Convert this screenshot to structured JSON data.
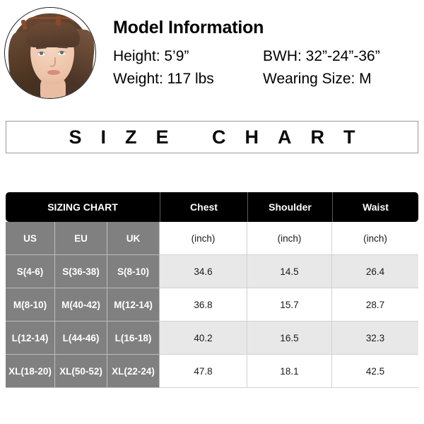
{
  "model": {
    "title": "Model Information",
    "photo_alt": "model-portrait",
    "rows": [
      {
        "left": "Height: 5’9”",
        "right": "BWH: 32”-24”-36”"
      },
      {
        "left": "Weight: 117 lbs",
        "right": "Wearing Size: M"
      }
    ]
  },
  "banner": {
    "text": "SIZE CHART"
  },
  "table": {
    "header": {
      "sizing_chart": "SIZING CHART",
      "chest": "Chest",
      "shoulder": "Shoulder",
      "waist": "Waist"
    },
    "subheader": {
      "us": "US",
      "eu": "EU",
      "uk": "UK",
      "chest_unit": "(inch)",
      "shoulder_unit": "(inch)",
      "waist_unit": "(inch)"
    },
    "rows": [
      {
        "us": "S(4-6)",
        "eu": "S(36-38)",
        "uk": "S(8-10)",
        "chest": "34.6",
        "shoulder": "14.5",
        "waist": "26.4"
      },
      {
        "us": "M(8-10)",
        "eu": "M(40-42)",
        "uk": "M(12-14)",
        "chest": "36.8",
        "shoulder": "15.7",
        "waist": "28.7"
      },
      {
        "us": "L(12-14)",
        "eu": "L(44-46)",
        "uk": "L(16-18)",
        "chest": "40.2",
        "shoulder": "16.5",
        "waist": "32.3"
      },
      {
        "us": "XL(18-20)",
        "eu": "XL(50-52)",
        "uk": "XL(22-24)",
        "chest": "47.8",
        "shoulder": "18.1",
        "waist": "42.5"
      }
    ]
  },
  "colors": {
    "header_bg": "#000000",
    "size_col_bg": "#808080",
    "row_shade_bg": "#e8e8e8",
    "row_plain_bg": "#ffffff",
    "banner_border": "#9a9a9a"
  }
}
